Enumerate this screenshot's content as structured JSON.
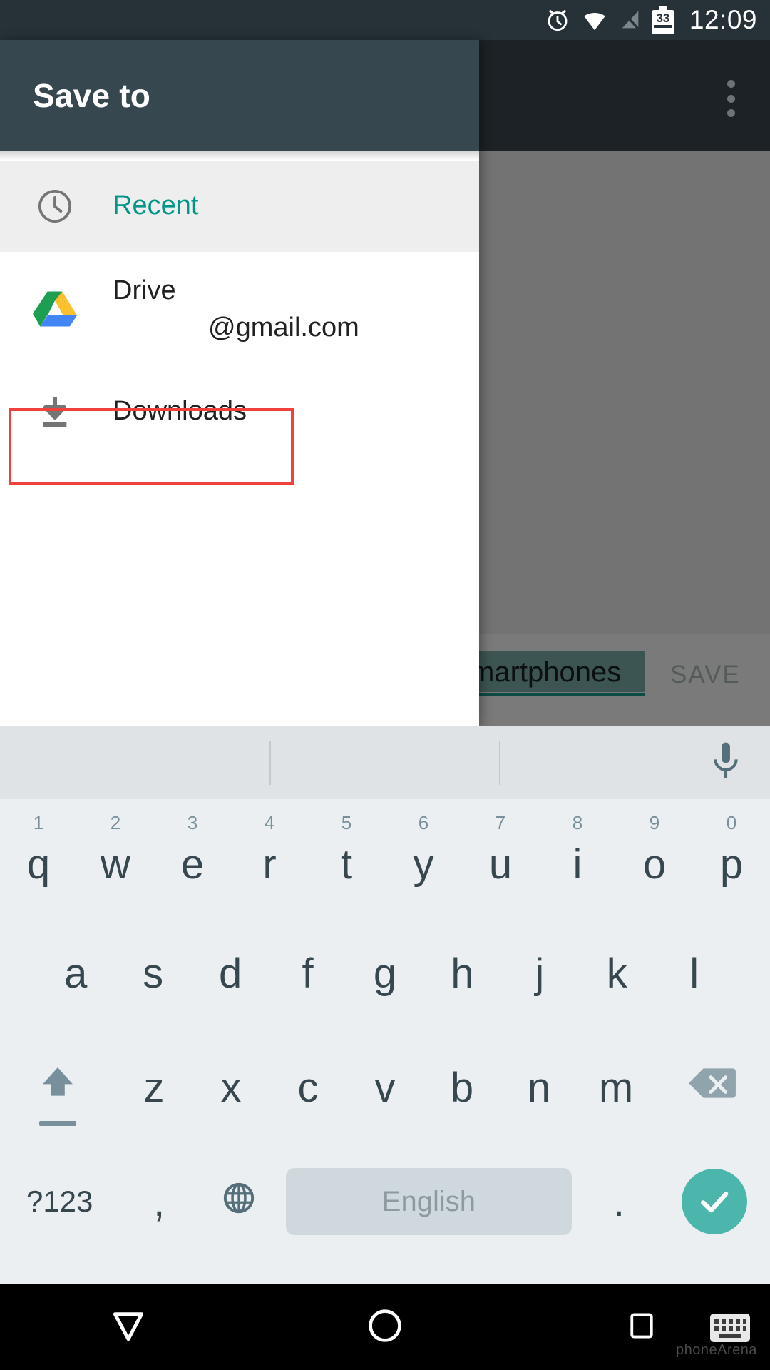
{
  "status_bar": {
    "time": "12:09",
    "battery_percent": "33",
    "icons": [
      "alarm-icon",
      "wifi-icon",
      "signal-off-icon",
      "battery-icon"
    ]
  },
  "background_app": {
    "overflow_menu": "overflow-menu",
    "text_field_value": "martphones",
    "save_button_label": "SAVE"
  },
  "drawer": {
    "title": "Save to",
    "items": [
      {
        "label": "Recent",
        "icon": "clock-icon",
        "selected": true,
        "accent": true
      },
      {
        "label": "Drive",
        "sub_label": "@gmail.com",
        "icon": "google-drive-icon",
        "selected": false,
        "accent": false
      },
      {
        "label": "Downloads",
        "icon": "download-icon",
        "selected": false,
        "accent": false,
        "highlighted": true
      }
    ]
  },
  "annotation": {
    "color": "#f0413c",
    "target": "Downloads"
  },
  "keyboard": {
    "suggestion_strip": {
      "suggestions": [
        "",
        "",
        ""
      ],
      "mic": "microphone-icon"
    },
    "row1": [
      {
        "key": "q",
        "hint": "1"
      },
      {
        "key": "w",
        "hint": "2"
      },
      {
        "key": "e",
        "hint": "3"
      },
      {
        "key": "r",
        "hint": "4"
      },
      {
        "key": "t",
        "hint": "5"
      },
      {
        "key": "y",
        "hint": "6"
      },
      {
        "key": "u",
        "hint": "7"
      },
      {
        "key": "i",
        "hint": "8"
      },
      {
        "key": "o",
        "hint": "9"
      },
      {
        "key": "p",
        "hint": "0"
      }
    ],
    "row2": [
      "a",
      "s",
      "d",
      "f",
      "g",
      "h",
      "j",
      "k",
      "l"
    ],
    "row3": {
      "shift": "shift-icon",
      "letters": [
        "z",
        "x",
        "c",
        "v",
        "b",
        "n",
        "m"
      ],
      "backspace": "backspace-icon"
    },
    "row4": {
      "symbols_label": "?123",
      "comma": ",",
      "globe": "globe-icon",
      "space_label": "English",
      "period": ".",
      "enter": "check-icon"
    }
  },
  "nav_bar": {
    "back": "down-triangle-icon",
    "home": "circle-icon",
    "recents": "square-icon",
    "keyboard_switcher": "keyboard-switch-icon",
    "watermark": "phoneArena"
  },
  "colors": {
    "status_bar": "#263238",
    "drawer_header": "#37474f",
    "accent_teal": "#009688",
    "enter_key": "#4db6ac",
    "annotation_red": "#f0413c",
    "keyboard_bg": "#eceff1"
  }
}
